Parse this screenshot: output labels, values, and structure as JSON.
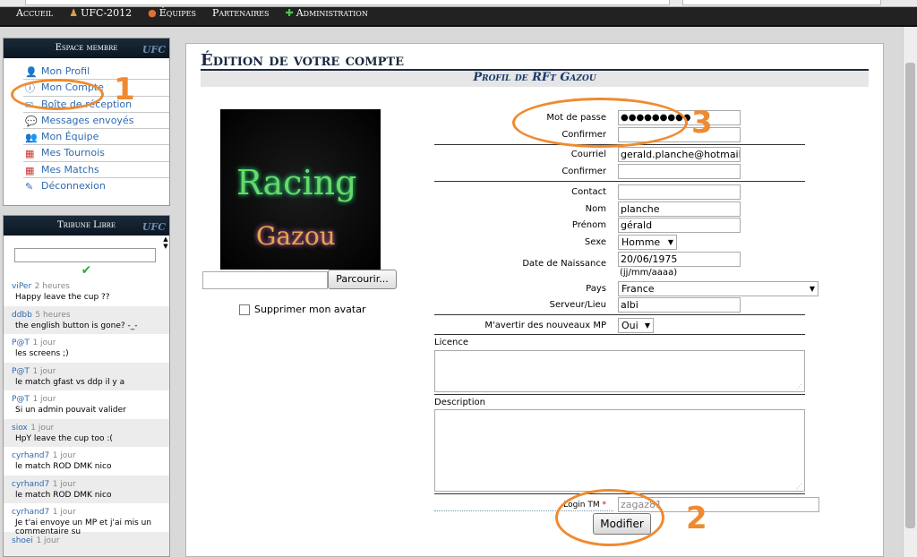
{
  "nav": [
    "Accueil",
    "UFC-2012",
    "Équipes",
    "Partenaires",
    "Administration"
  ],
  "espace_membre": {
    "header": "Espace membre",
    "logo": "UFC",
    "items": [
      "Mon Profil",
      "Mon Compte",
      "Boîte de réception",
      "Messages envoyés",
      "Mon Équipe",
      "Mes Tournois",
      "Mes Matchs",
      "Déconnexion"
    ]
  },
  "tribune": {
    "header": "Tribune Libre",
    "logo": "UFC",
    "messages": [
      {
        "user": "viPer",
        "when": "2 heures",
        "text": "Happy leave the cup ??"
      },
      {
        "user": "ddbb",
        "when": "5 heures",
        "text": "the english button is gone? -_-"
      },
      {
        "user": "P@T",
        "when": "1 jour",
        "text": "les screens ;)"
      },
      {
        "user": "P@T",
        "when": "1 jour",
        "text": "le match gfast vs ddp il y a"
      },
      {
        "user": "P@T",
        "when": "1 jour",
        "text": "Si un admin pouvait valider"
      },
      {
        "user": "siox",
        "when": "1 jour",
        "text": "HpY leave the cup too :("
      },
      {
        "user": "cyrhand7",
        "when": "1 jour",
        "text": "le match ROD DMK nico"
      },
      {
        "user": "cyrhand7",
        "when": "1 jour",
        "text": "le match ROD DMK nico"
      },
      {
        "user": "cyrhand7",
        "when": "1 jour",
        "text": "Je t'ai envoye un MP et j'ai mis un commentaire su"
      },
      {
        "user": "shoei",
        "when": "1 jour",
        "text": ""
      }
    ]
  },
  "main": {
    "title": "Édition de votre compte",
    "profile_header": "Profil de RFt Gazou",
    "avatar_text_1": "Racing",
    "avatar_text_2": "Gazou",
    "browse_label": "Parcourir...",
    "delete_avatar_label": "Supprimer mon avatar",
    "form": {
      "password_label": "Mot de passe",
      "password_value": "●●●●●●●●●",
      "confirm_label": "Confirmer",
      "email_label": "Courriel",
      "email_value": "gerald.planche@hotmail",
      "email_confirm_label": "Confirmer",
      "contact_label": "Contact",
      "nom_label": "Nom",
      "nom_value": "planche",
      "prenom_label": "Prénom",
      "prenom_value": "gérald",
      "sexe_label": "Sexe",
      "sexe_value": "Homme",
      "dob_label": "Date de Naissance",
      "dob_value": "20/06/1975",
      "dob_hint": "(jj/mm/aaaa)",
      "pays_label": "Pays",
      "pays_value": "France",
      "serveur_label": "Serveur/Lieu",
      "serveur_value": "albi",
      "notify_label": "M'avertir des nouveaux MP",
      "notify_value": "Oui",
      "licence_label": "Licence",
      "description_label": "Description",
      "login_label": "Login TM",
      "login_required": "*",
      "login_value": "zagaz81",
      "submit_label": "Modifier"
    }
  },
  "annotations": [
    "1",
    "2",
    "3"
  ],
  "colors": {
    "annotation": "#f08a30",
    "link": "#2e6ab1",
    "title": "#1a2a44"
  }
}
